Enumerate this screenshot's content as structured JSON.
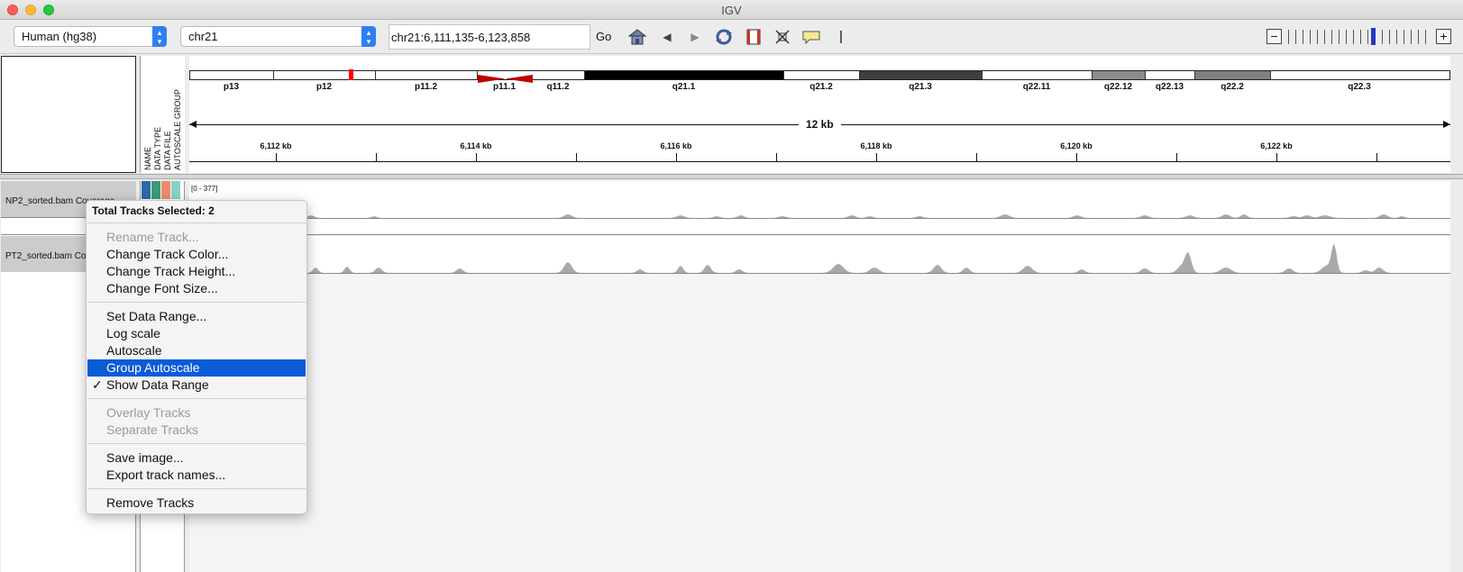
{
  "window": {
    "title": "IGV"
  },
  "toolbar": {
    "genome": "Human (hg38)",
    "chromosome": "chr21",
    "locus": "chr21:6,111,135-6,123,858",
    "go_label": "Go",
    "icons": [
      "home-icon",
      "back-icon",
      "forward-icon",
      "refresh-icon",
      "region-icon",
      "fit-icon",
      "popup-info-icon",
      "ruler-line-icon"
    ],
    "zoom_minus": "−",
    "zoom_plus": "+"
  },
  "attributes": {
    "headers": [
      "NAME",
      "DATA TYPE",
      "DATA FILE",
      "AUTOSCALE GROUP"
    ]
  },
  "ideogram": {
    "bands": [
      {
        "label": "p13",
        "color": "#ffffff"
      },
      {
        "label": "p12",
        "color": "#ffffff"
      },
      {
        "label": "p11.2",
        "color": "#ffffff"
      },
      {
        "label": "p11.1",
        "color": "#c00000"
      },
      {
        "label": "q11.2",
        "color": "#ffffff"
      },
      {
        "label": "q21.1",
        "color": "#000000"
      },
      {
        "label": "q21.2",
        "color": "#ffffff"
      },
      {
        "label": "q21.3",
        "color": "#3f3f3f"
      },
      {
        "label": "q22.11",
        "color": "#ffffff"
      },
      {
        "label": "q22.12",
        "color": "#8c8c8c"
      },
      {
        "label": "q22.13",
        "color": "#ffffff"
      },
      {
        "label": "q22.2",
        "color": "#808080"
      },
      {
        "label": "q22.3",
        "color": "#ffffff"
      }
    ],
    "highlight_color": "#ff0000"
  },
  "ruler": {
    "span": "12 kb",
    "ticks": [
      "6,112 kb",
      "6,114 kb",
      "6,116 kb",
      "6,118 kb",
      "6,120 kb",
      "6,122 kb"
    ]
  },
  "tracks": [
    {
      "name": "NP2_sorted.bam Coverage",
      "range": "[0 - 377]",
      "attr_colors": [
        "#2d6aa8",
        "#3a9a7a",
        "#f08a6a",
        "#8ad0c8"
      ]
    },
    {
      "name": "PT2_sorted.bam Coverage",
      "range": "",
      "attr_colors": []
    }
  ],
  "context_menu": {
    "header": "Total Tracks Selected: 2",
    "items": [
      {
        "label": "Rename Track...",
        "enabled": false
      },
      {
        "label": "Change Track Color...",
        "enabled": true
      },
      {
        "label": "Change Track Height...",
        "enabled": true
      },
      {
        "label": "Change Font Size...",
        "enabled": true
      },
      {
        "label": "Set Data Range...",
        "enabled": true
      },
      {
        "label": "Log scale",
        "enabled": true
      },
      {
        "label": "Autoscale",
        "enabled": true
      },
      {
        "label": "Group Autoscale",
        "enabled": true,
        "selected": true
      },
      {
        "label": "Show Data Range",
        "enabled": true,
        "checked": true
      },
      {
        "label": "Overlay Tracks",
        "enabled": false
      },
      {
        "label": "Separate Tracks",
        "enabled": false
      },
      {
        "label": "Save image...",
        "enabled": true
      },
      {
        "label": "Export track names...",
        "enabled": true
      },
      {
        "label": "Remove Tracks",
        "enabled": true
      }
    ],
    "check_mark": "✓"
  },
  "colors": {
    "coverage": "#a9a9a9",
    "selection": "#0a5bd8"
  }
}
